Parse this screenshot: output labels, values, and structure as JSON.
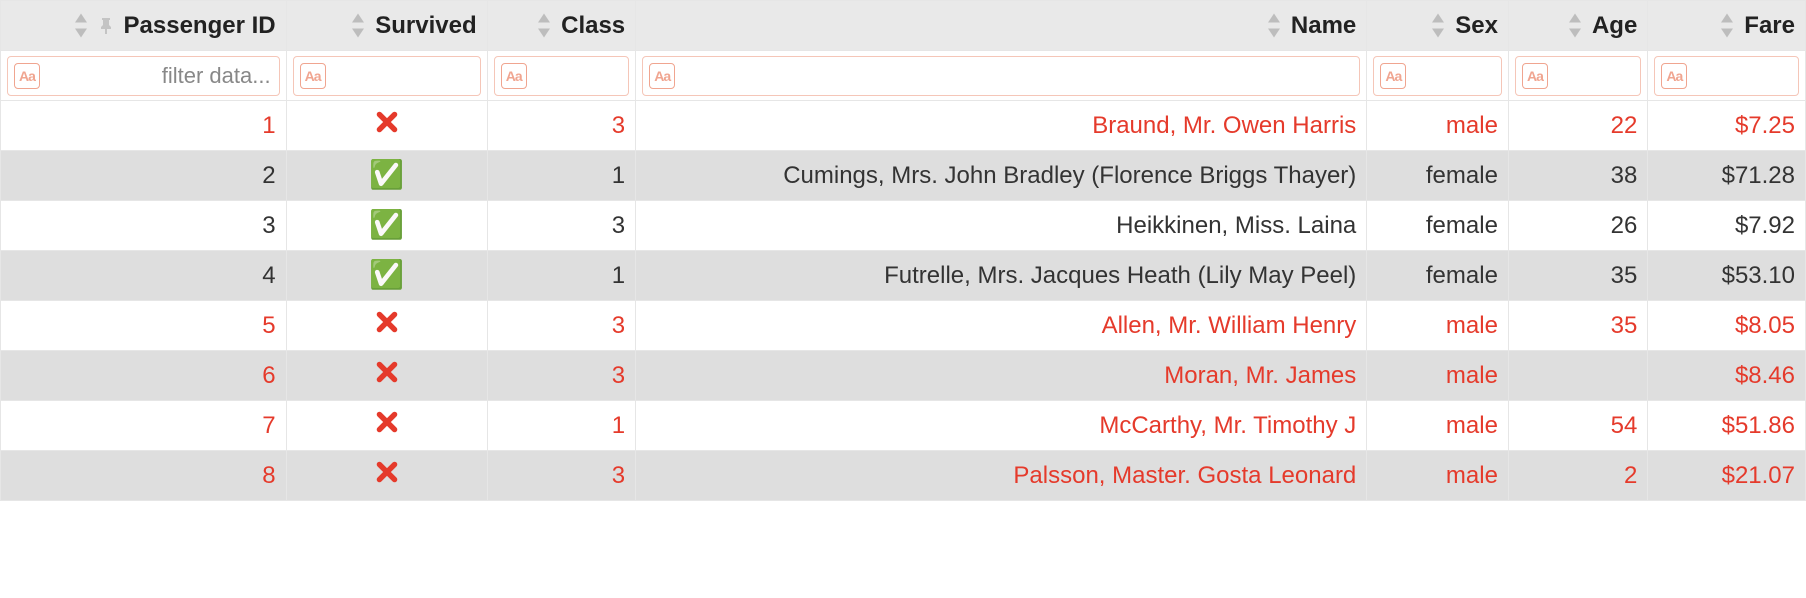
{
  "table": {
    "columns": [
      {
        "key": "pid",
        "label": "Passenger ID",
        "pin": true
      },
      {
        "key": "surv",
        "label": "Survived"
      },
      {
        "key": "class",
        "label": "Class"
      },
      {
        "key": "name",
        "label": "Name"
      },
      {
        "key": "sex",
        "label": "Sex"
      },
      {
        "key": "age",
        "label": "Age"
      },
      {
        "key": "fare",
        "label": "Fare"
      }
    ],
    "filter_placeholder": "filter data...",
    "icons": {
      "filter_badge": "Aa",
      "survived_true": "✅",
      "survived_false": "✖"
    },
    "rows": [
      {
        "pid": "1",
        "survived": false,
        "class": "3",
        "name": "Braund, Mr. Owen Harris",
        "sex": "male",
        "age": "22",
        "fare": "$7.25"
      },
      {
        "pid": "2",
        "survived": true,
        "class": "1",
        "name": "Cumings, Mrs. John Bradley (Florence Briggs Thayer)",
        "sex": "female",
        "age": "38",
        "fare": "$71.28"
      },
      {
        "pid": "3",
        "survived": true,
        "class": "3",
        "name": "Heikkinen, Miss. Laina",
        "sex": "female",
        "age": "26",
        "fare": "$7.92"
      },
      {
        "pid": "4",
        "survived": true,
        "class": "1",
        "name": "Futrelle, Mrs. Jacques Heath (Lily May Peel)",
        "sex": "female",
        "age": "35",
        "fare": "$53.10"
      },
      {
        "pid": "5",
        "survived": false,
        "class": "3",
        "name": "Allen, Mr. William Henry",
        "sex": "male",
        "age": "35",
        "fare": "$8.05"
      },
      {
        "pid": "6",
        "survived": false,
        "class": "3",
        "name": "Moran, Mr. James",
        "sex": "male",
        "age": "",
        "fare": "$8.46"
      },
      {
        "pid": "7",
        "survived": false,
        "class": "1",
        "name": "McCarthy, Mr. Timothy J",
        "sex": "male",
        "age": "54",
        "fare": "$51.86"
      },
      {
        "pid": "8",
        "survived": false,
        "class": "3",
        "name": "Palsson, Master. Gosta Leonard",
        "sex": "male",
        "age": "2",
        "fare": "$21.07"
      }
    ]
  }
}
